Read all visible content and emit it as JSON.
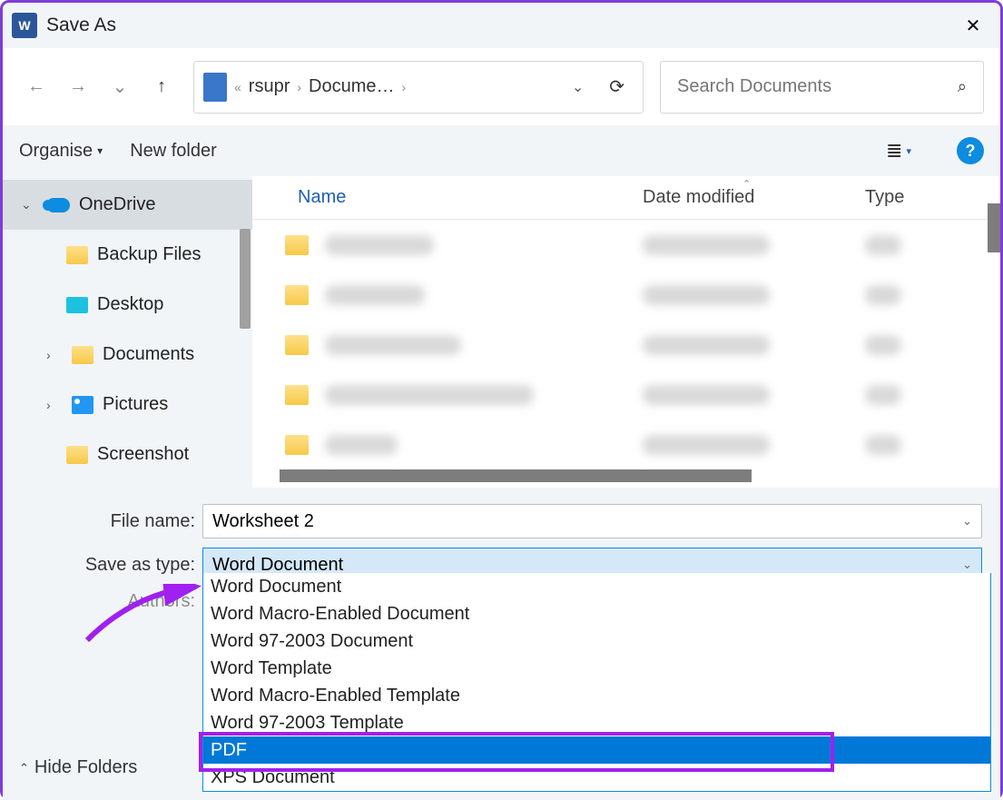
{
  "title": "Save As",
  "close_glyph": "✕",
  "nav": {
    "back": "←",
    "fwd": "→",
    "recent": "⌄",
    "up": "↑"
  },
  "breadcrumb": {
    "prefix": "«",
    "p1": "rsupr",
    "sep": "›",
    "p2": "Docume…",
    "chev": "⌄",
    "refresh": "⟳"
  },
  "search": {
    "placeholder": "Search Documents",
    "icon": "⌕"
  },
  "toolbar": {
    "organise": "Organise",
    "organise_caret": "▾",
    "new_folder": "New folder",
    "view": "≣",
    "view_caret": "▾",
    "help": "?"
  },
  "sidebar": {
    "items": [
      {
        "label": "OneDrive",
        "icon": "onedrive",
        "expand": "⌄",
        "selected": true
      },
      {
        "label": "Backup Files",
        "icon": "folder",
        "indent": true
      },
      {
        "label": "Desktop",
        "icon": "desktop",
        "indent": true
      },
      {
        "label": "Documents",
        "icon": "folder",
        "expand": "›",
        "indent": true
      },
      {
        "label": "Pictures",
        "icon": "pictures",
        "expand": "›",
        "indent": true
      },
      {
        "label": "Screenshot",
        "icon": "folder",
        "indent": true
      }
    ]
  },
  "filelist": {
    "cols": {
      "name": "Name",
      "date": "Date modified",
      "type": "Type"
    },
    "rows": [
      {
        "nw": 120,
        "dw": 140,
        "tw": 40
      },
      {
        "nw": 110,
        "dw": 140,
        "tw": 40
      },
      {
        "nw": 150,
        "dw": 140,
        "tw": 40
      },
      {
        "nw": 230,
        "dw": 140,
        "tw": 40
      },
      {
        "nw": 80,
        "dw": 140,
        "tw": 40
      }
    ]
  },
  "form": {
    "filename_label": "File name:",
    "filename_value": "Worksheet 2",
    "saveastype_label": "Save as type:",
    "saveastype_value": "Word Document",
    "authors_label": "Authors:",
    "hide_folders": "Hide Folders",
    "hide_caret": "⌃",
    "dropdown": [
      "Word Document",
      "Word Macro-Enabled Document",
      "Word 97-2003 Document",
      "Word Template",
      "Word Macro-Enabled Template",
      "Word 97-2003 Template",
      "PDF",
      "XPS Document"
    ],
    "highlighted_index": 6
  },
  "annotation": {
    "arrow_color": "#a020f0"
  }
}
